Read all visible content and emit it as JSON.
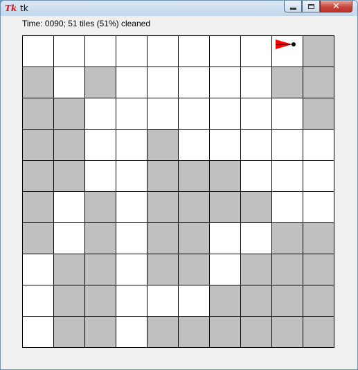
{
  "window": {
    "title": "tk",
    "app_icon": "Tk",
    "close_glyph": "✕"
  },
  "status_text": "Time: 0090; 51 tiles (51%) cleaned",
  "colors": {
    "clean": "#ffffff",
    "dirty": "#c0c0c0",
    "grid_line": "#000000",
    "robot": "#ff0000"
  },
  "grid": {
    "rows": 10,
    "cols": 10,
    "cells": [
      [
        0,
        0,
        0,
        0,
        0,
        0,
        0,
        0,
        0,
        1
      ],
      [
        1,
        0,
        1,
        0,
        0,
        0,
        0,
        0,
        1,
        1
      ],
      [
        1,
        1,
        0,
        0,
        0,
        0,
        0,
        0,
        0,
        1
      ],
      [
        1,
        1,
        0,
        0,
        1,
        0,
        0,
        0,
        0,
        0
      ],
      [
        1,
        1,
        0,
        0,
        1,
        1,
        1,
        0,
        0,
        0
      ],
      [
        1,
        0,
        1,
        0,
        1,
        1,
        1,
        1,
        0,
        0
      ],
      [
        1,
        0,
        1,
        0,
        1,
        1,
        0,
        0,
        1,
        1
      ],
      [
        0,
        1,
        1,
        0,
        1,
        1,
        0,
        1,
        1,
        1
      ],
      [
        0,
        1,
        1,
        0,
        0,
        0,
        1,
        1,
        1,
        1
      ],
      [
        0,
        1,
        1,
        0,
        1,
        1,
        1,
        1,
        1,
        1
      ]
    ]
  },
  "robot": {
    "row": 0,
    "col": 8,
    "direction": "east"
  }
}
